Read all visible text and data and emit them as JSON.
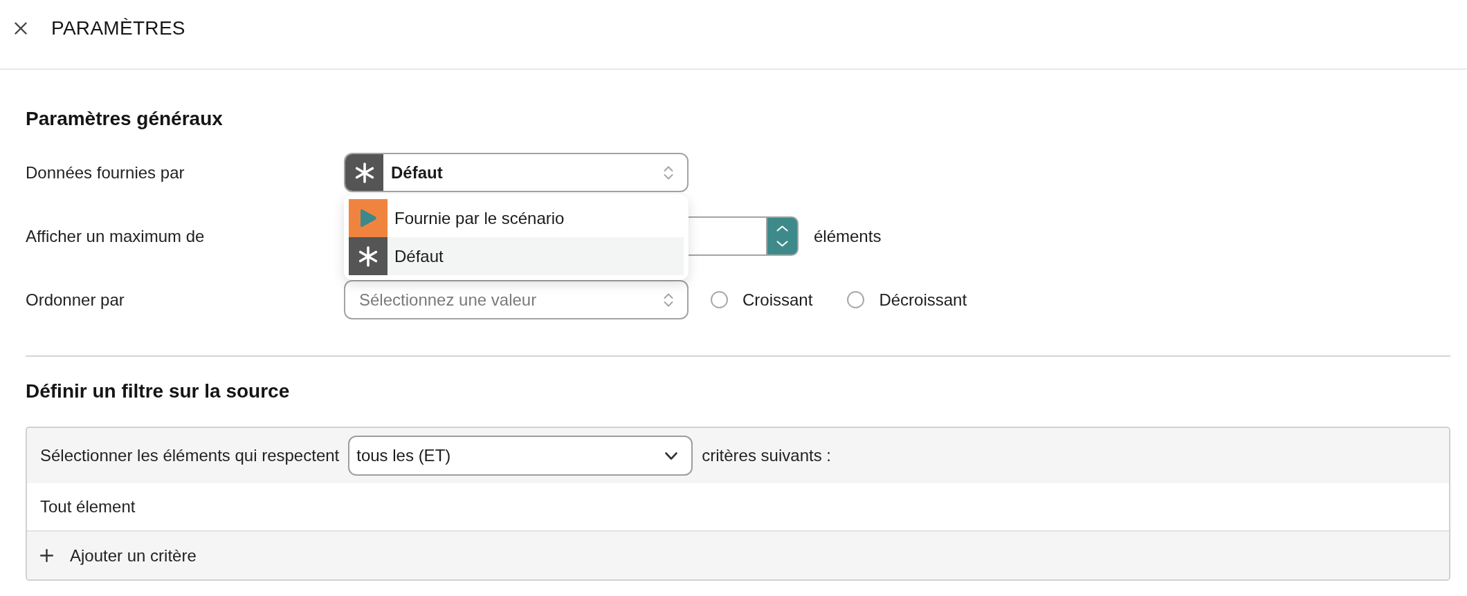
{
  "header": {
    "title": "PARAMÈTRES"
  },
  "general": {
    "title": "Paramètres généraux",
    "rows": [
      {
        "kind": "select",
        "label": "Données fournies par",
        "value": {
          "kind": "default",
          "label": "Défaut"
        },
        "expanded": true,
        "options": [
          {
            "kind": "scenario",
            "label": "Fournie par le scénario",
            "selected": false
          },
          {
            "kind": "default",
            "label": "Défaut",
            "selected": true
          }
        ]
      },
      {
        "kind": "number",
        "label": "Afficher un maximum de",
        "unit": "éléments"
      },
      {
        "kind": "sort",
        "label": "Ordonner par",
        "placeholder": "Sélectionnez une valeur",
        "options": [
          {
            "label": "Croissant",
            "selected": false
          },
          {
            "label": "Décroissant",
            "selected": false
          }
        ]
      }
    ]
  },
  "filter": {
    "title": "Définir un filtre sur la source",
    "prefix": "Sélectionner les éléments qui respectent",
    "mode": "tous les (ET)",
    "suffix": "critères suivants :",
    "body_text": "Tout élement",
    "add_label": "Ajouter un critère"
  }
}
